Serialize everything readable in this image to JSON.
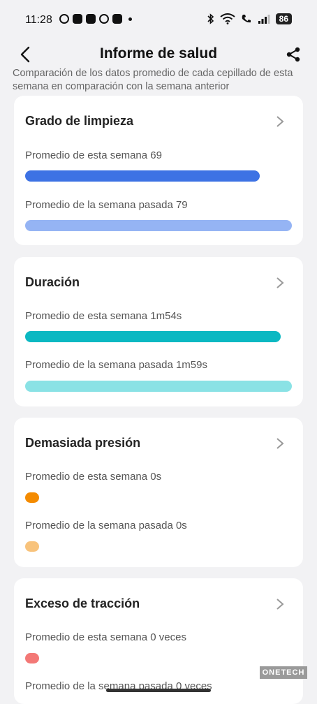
{
  "status_bar": {
    "time": "11:28",
    "battery": "86"
  },
  "header": {
    "title": "Informe de salud"
  },
  "intro_text": "Comparación de los datos promedio de cada cepillado de esta semana en comparación con la semana anterior",
  "cards": [
    {
      "title": "Grado de limpieza",
      "this_week": "Promedio de esta semana 69",
      "last_week": "Promedio de la semana pasada 79",
      "this_week_value": 0.69,
      "last_week_value": 0.79,
      "this_color": "#3d72e4",
      "last_color": "#95b4f4"
    },
    {
      "title": "Duración",
      "this_week": "Promedio de esta semana 1m54s",
      "last_week": "Promedio de la semana pasada 1m59s",
      "this_week_value": "1m54s",
      "last_week_value": "1m59s",
      "this_color": "#0bb8c2",
      "last_color": "#8ae2e5"
    },
    {
      "title": "Demasiada presión",
      "this_week": "Promedio de esta semana 0s",
      "last_week": "Promedio de la semana pasada 0s",
      "this_week_value": 0,
      "last_week_value": 0,
      "this_color": "#f48b00",
      "last_color": "#f8c37c"
    },
    {
      "title": "Exceso de tracción",
      "this_week": "Promedio de esta semana 0 veces",
      "last_week": "Promedio de la semana pasada 0 veces",
      "this_week_value": 0,
      "last_week_value": 0,
      "this_color": "#f37876",
      "last_color": "#f8b4b3"
    }
  ],
  "watermark": "ONETECH"
}
